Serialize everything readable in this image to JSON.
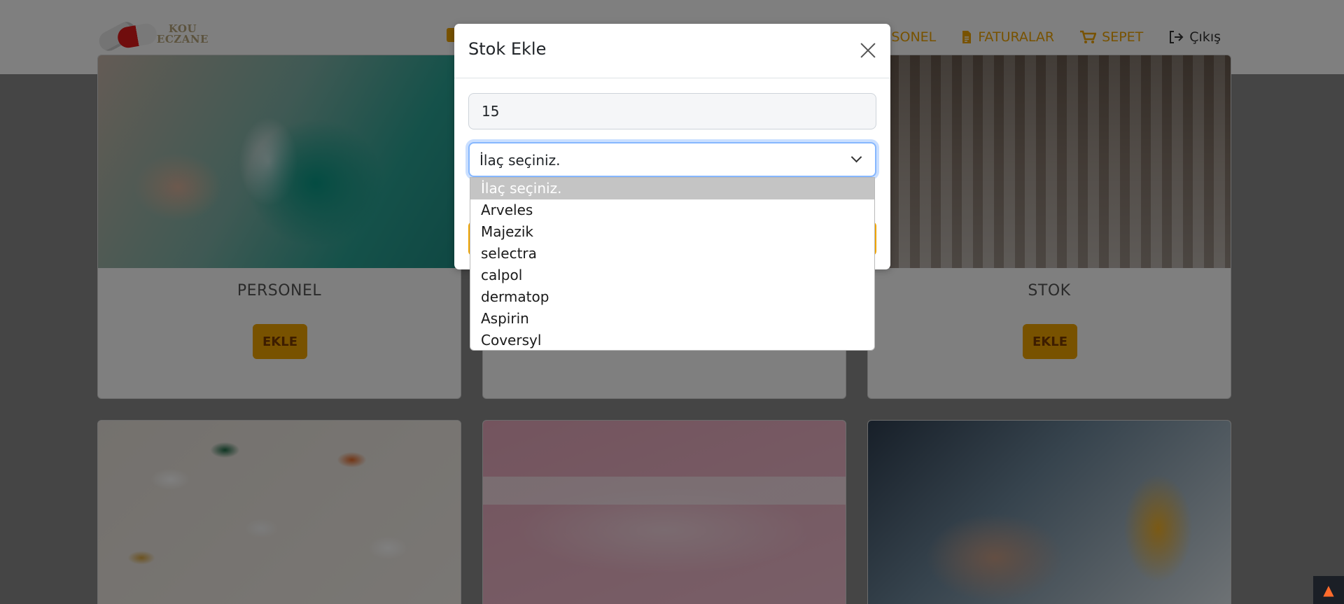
{
  "navbar": {
    "logo_text_1": "KOU",
    "logo_text_2": "ECZANE",
    "links": [
      {
        "label": "SONEL",
        "icon": "users-icon"
      },
      {
        "label": "FATURALAR",
        "icon": "file-icon"
      },
      {
        "label": "SEPET",
        "icon": "cart-icon"
      },
      {
        "label": "Çıkış",
        "icon": "logout-icon"
      }
    ]
  },
  "cards": [
    {
      "title": "PERSONEL",
      "button": "EKLE"
    },
    {
      "title": "",
      "button": ""
    },
    {
      "title": "STOK",
      "button": "EKLE"
    }
  ],
  "modal": {
    "title": "Stok Ekle",
    "quantity_value": "15",
    "select_value": "İlaç seçiniz.",
    "options": [
      "İlaç seçiniz.",
      "Arveles",
      "Majezik",
      "selectra",
      "calpol",
      "dermatop",
      "Aspirin",
      "Coversyl"
    ],
    "selected_index": 0
  },
  "colors": {
    "accent": "#f0a500",
    "backdrop": "rgba(0,0,0,0.5)",
    "focus_ring": "#86b7fe"
  }
}
